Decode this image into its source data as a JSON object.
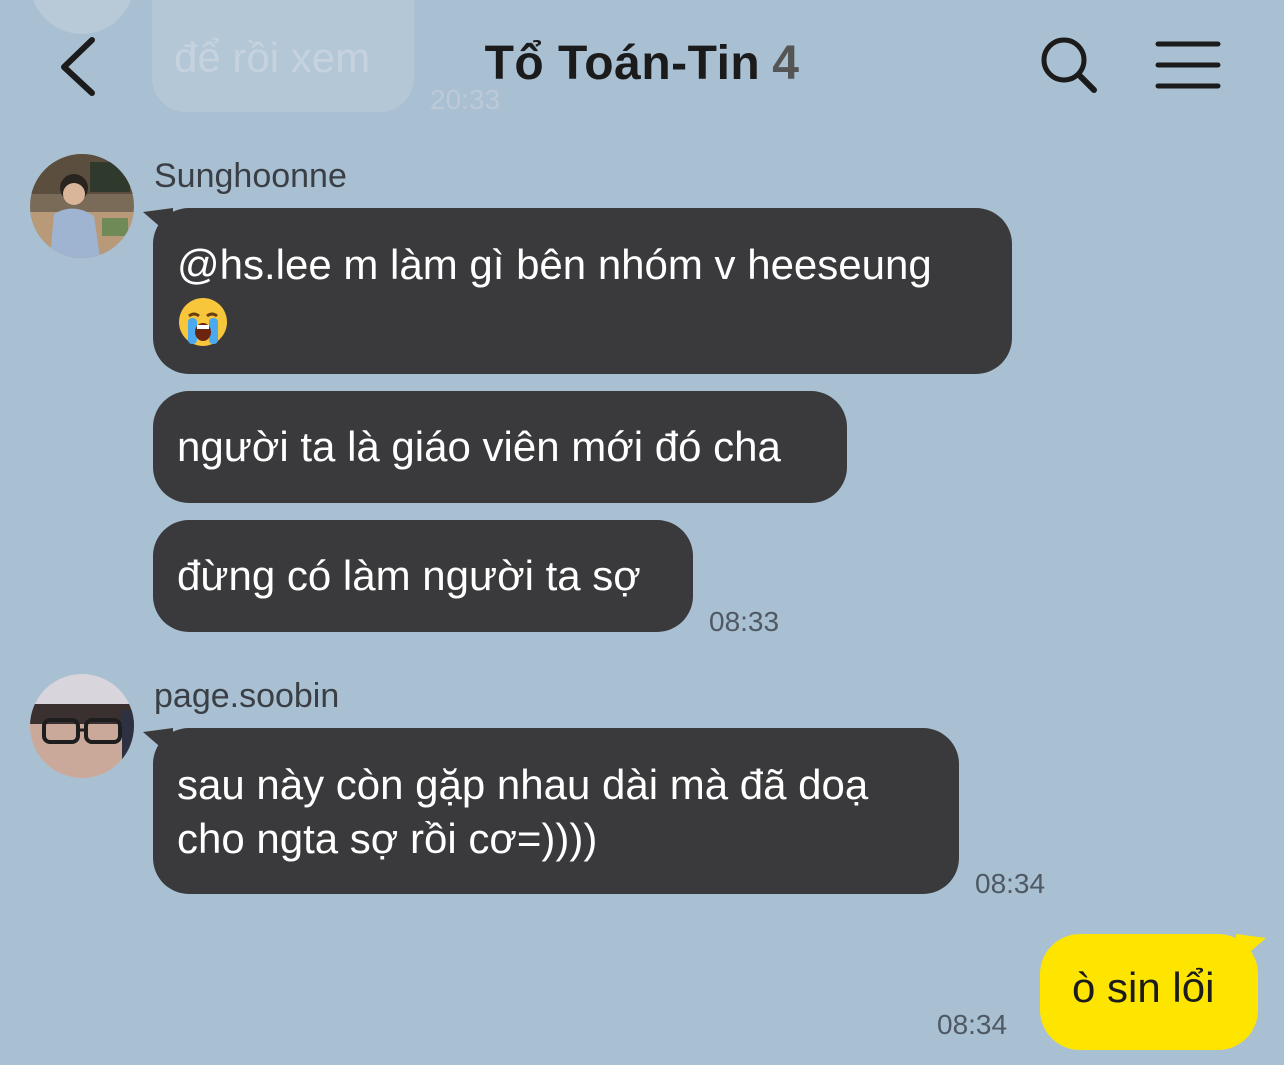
{
  "previous_message": {
    "text": "để rồi xem",
    "time": "20:33"
  },
  "header": {
    "title": "Tổ Toán-Tin",
    "member_count": "4"
  },
  "messages": [
    {
      "sender": "Sunghoonne",
      "bubbles": [
        "@hs.lee m làm gì bên nhóm v heeseung",
        "người ta là giáo viên mới đó cha",
        "đừng có làm người ta sợ"
      ],
      "emoji": "loudly-crying-face-emoji",
      "time": "08:33"
    },
    {
      "sender": "page.soobin",
      "bubbles": [
        "sau này còn gặp nhau dài mà đã doạ",
        "cho ngta sợ rồi cơ=))))"
      ],
      "time": "08:34"
    }
  ],
  "my_message": {
    "text": "ò sin lổi",
    "time": "08:34"
  },
  "colors": {
    "background": "#a9c0d3",
    "incoming_bubble": "#3a3a3c",
    "outgoing_bubble": "#fee500"
  }
}
